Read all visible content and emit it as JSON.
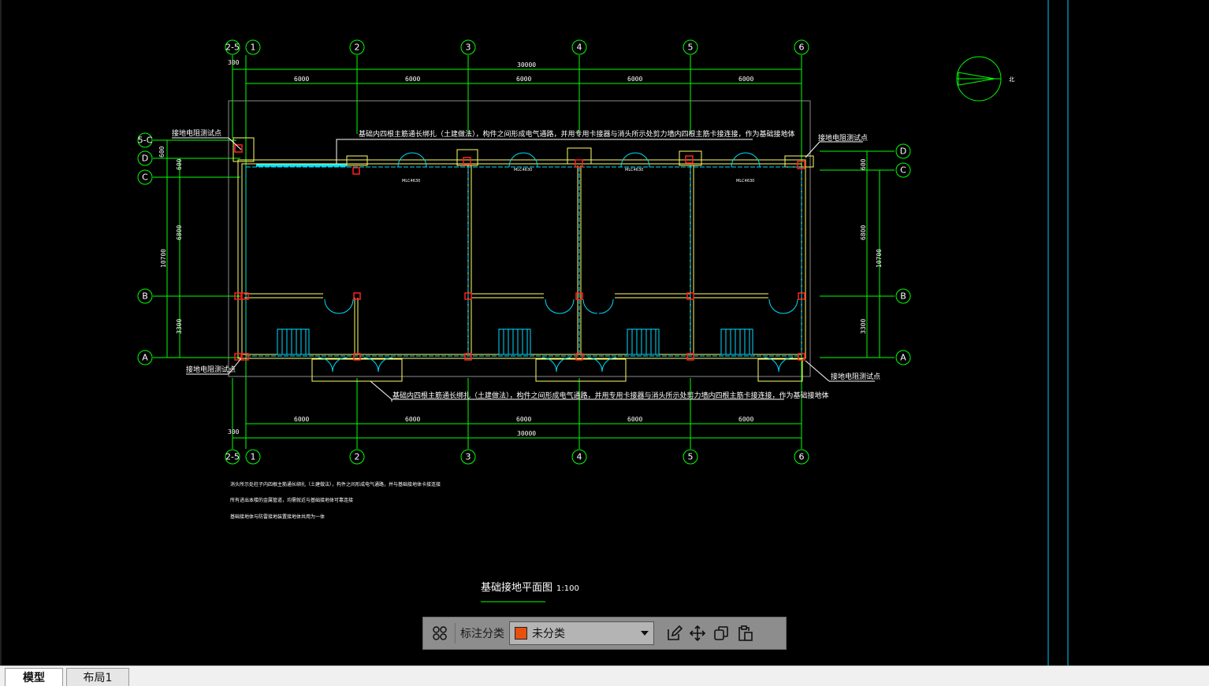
{
  "drawing": {
    "top_note": "基础内四根主筋通长绑扎（土建做法），构件之间形成电气通路，并用专用卡接器与消头所示处剪力墙内四根主筋卡接连接，作为基础接地体",
    "bottom_note": "基础内四根主筋通长绑扎（土建做法），构件之间形成电气通路，并用专用卡接器与消头所示处剪力墙内四根主筋卡接连接，作为基础接地体",
    "test_point": "接地电阻测试点",
    "title": "基础接地平面图",
    "scale": "1:100",
    "notes": [
      "消头所示处柱子内四根主筋通长绑扎（土建做法），构件之间形成电气通路，并与基础接地体卡接连接",
      "所有进出本楼的金属管道，均需就近与基础接地体可靠连接",
      "基础接地体与防雷接地装置接地体共用为一体"
    ],
    "north": "北",
    "col_axes": [
      "2-5",
      "1",
      "2",
      "3",
      "4",
      "5",
      "6"
    ],
    "row_axes_left": [
      "5-C",
      "D",
      "C",
      "B",
      "A"
    ],
    "row_axes_right": [
      "D",
      "C",
      "B",
      "A"
    ],
    "spans": [
      "6000",
      "6000",
      "6000",
      "6000",
      "6000"
    ],
    "total_width": "30000",
    "offset": "300",
    "left_dims": [
      "600",
      "600",
      "6800",
      "10700",
      "3300"
    ],
    "right_dims": [
      "600",
      "6800",
      "10700",
      "3300"
    ],
    "window_tags": [
      "MLC4630",
      "MLC4630",
      "MLC4630",
      "MLC4630"
    ]
  },
  "toolbar": {
    "label": "标注分类",
    "selected": "未分类",
    "swatch_color": "#e8500e"
  },
  "tabs": [
    "模型",
    "布局1"
  ]
}
